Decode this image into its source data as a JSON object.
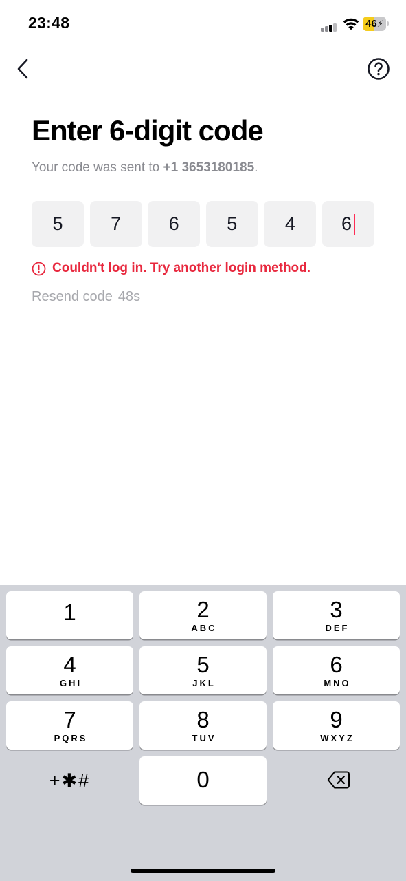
{
  "status_bar": {
    "time": "23:48",
    "battery_label": "46",
    "battery_percent": 46,
    "signal_icon": "cellular-signal-icon",
    "wifi_icon": "wifi-icon",
    "battery_icon": "battery-charging-icon"
  },
  "nav": {
    "back_icon": "chevron-left-icon",
    "help_icon": "question-circle-icon"
  },
  "header": {
    "title": "Enter 6-digit code",
    "subtitle_prefix": "Your code was sent to ",
    "phone": "+1 3653180185",
    "subtitle_suffix": "."
  },
  "code": {
    "digits": [
      "5",
      "7",
      "6",
      "5",
      "4",
      "6"
    ]
  },
  "error": {
    "icon": "info-circle-icon",
    "message": "Couldn't log in. Try another login method."
  },
  "resend": {
    "label": "Resend code",
    "countdown": "48s"
  },
  "keypad": {
    "keys": [
      {
        "num": "1",
        "letters": ""
      },
      {
        "num": "2",
        "letters": "ABC"
      },
      {
        "num": "3",
        "letters": "DEF"
      },
      {
        "num": "4",
        "letters": "GHI"
      },
      {
        "num": "5",
        "letters": "JKL"
      },
      {
        "num": "6",
        "letters": "MNO"
      },
      {
        "num": "7",
        "letters": "PQRS"
      },
      {
        "num": "8",
        "letters": "TUV"
      },
      {
        "num": "9",
        "letters": "WXYZ"
      },
      {
        "num": "0",
        "letters": ""
      }
    ],
    "symbols_label": "+✱#",
    "backspace_icon": "backspace-icon"
  },
  "colors": {
    "error": "#e8283e",
    "caret": "#fe2c55",
    "code_box": "#f1f1f2",
    "keyboard_bg": "#d1d3d9",
    "battery_fill": "#f5cc1b"
  }
}
